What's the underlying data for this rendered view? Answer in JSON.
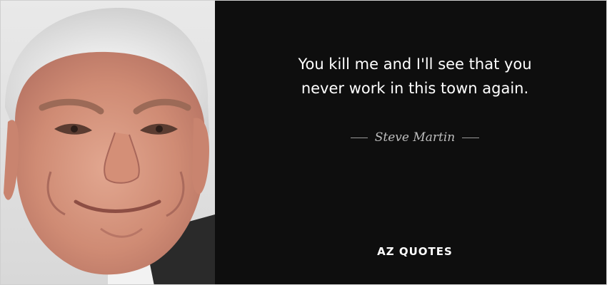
{
  "quote": {
    "line1": "You kill me and I'll see that you",
    "line2": "never work in this town again."
  },
  "author": {
    "name": "Steve Martin"
  },
  "brand": {
    "logo_text": "AZ QUOTES"
  },
  "colors": {
    "background": "#0e0e0e",
    "quote_text": "#ffffff",
    "author_text": "#bdbdbd"
  }
}
